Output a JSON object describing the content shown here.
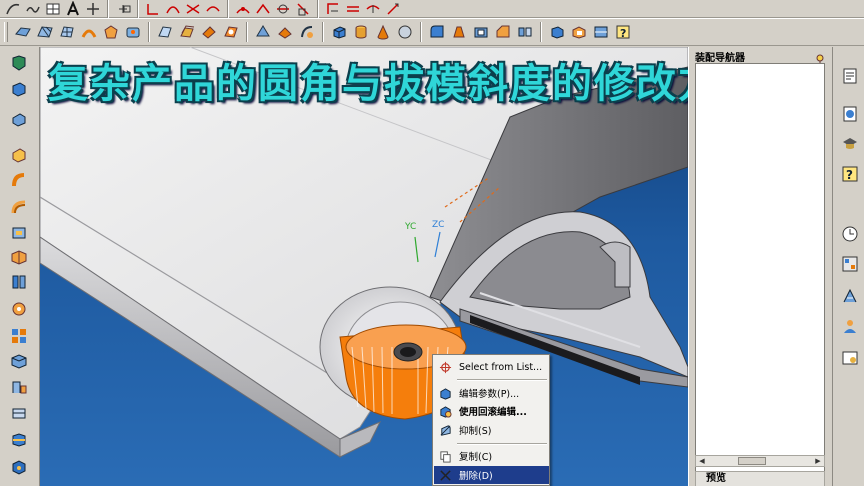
{
  "title_overlay": "复杂产品的圆角与拔模斜度的修改方法",
  "navigator": {
    "title": "装配导航器",
    "preview_label": "预览"
  },
  "context_menu": {
    "items": [
      {
        "label": "Select from List...",
        "icon": "crosshair-icon"
      },
      {
        "label": "编辑参数(P)...",
        "icon": "edit-parameters-icon"
      },
      {
        "label": "使用回滚编辑...",
        "icon": "rollback-edit-icon"
      },
      {
        "label": "抑制(S)",
        "icon": "suppress-icon"
      },
      {
        "label": "复制(C)",
        "icon": "copy-icon"
      },
      {
        "label": "删除(D)",
        "icon": "delete-icon"
      }
    ],
    "highlighted_index": 5
  },
  "viewport": {
    "axis_labels": [
      "YC",
      "ZC"
    ]
  },
  "colors": {
    "title_text": "#2fd6d8",
    "title_outline": "#0b3f4c",
    "highlight": "#1e3d8c",
    "feature_face": "#f57e0c",
    "background_top": "#0f3d78",
    "background_bottom": "#2a6cb5"
  }
}
